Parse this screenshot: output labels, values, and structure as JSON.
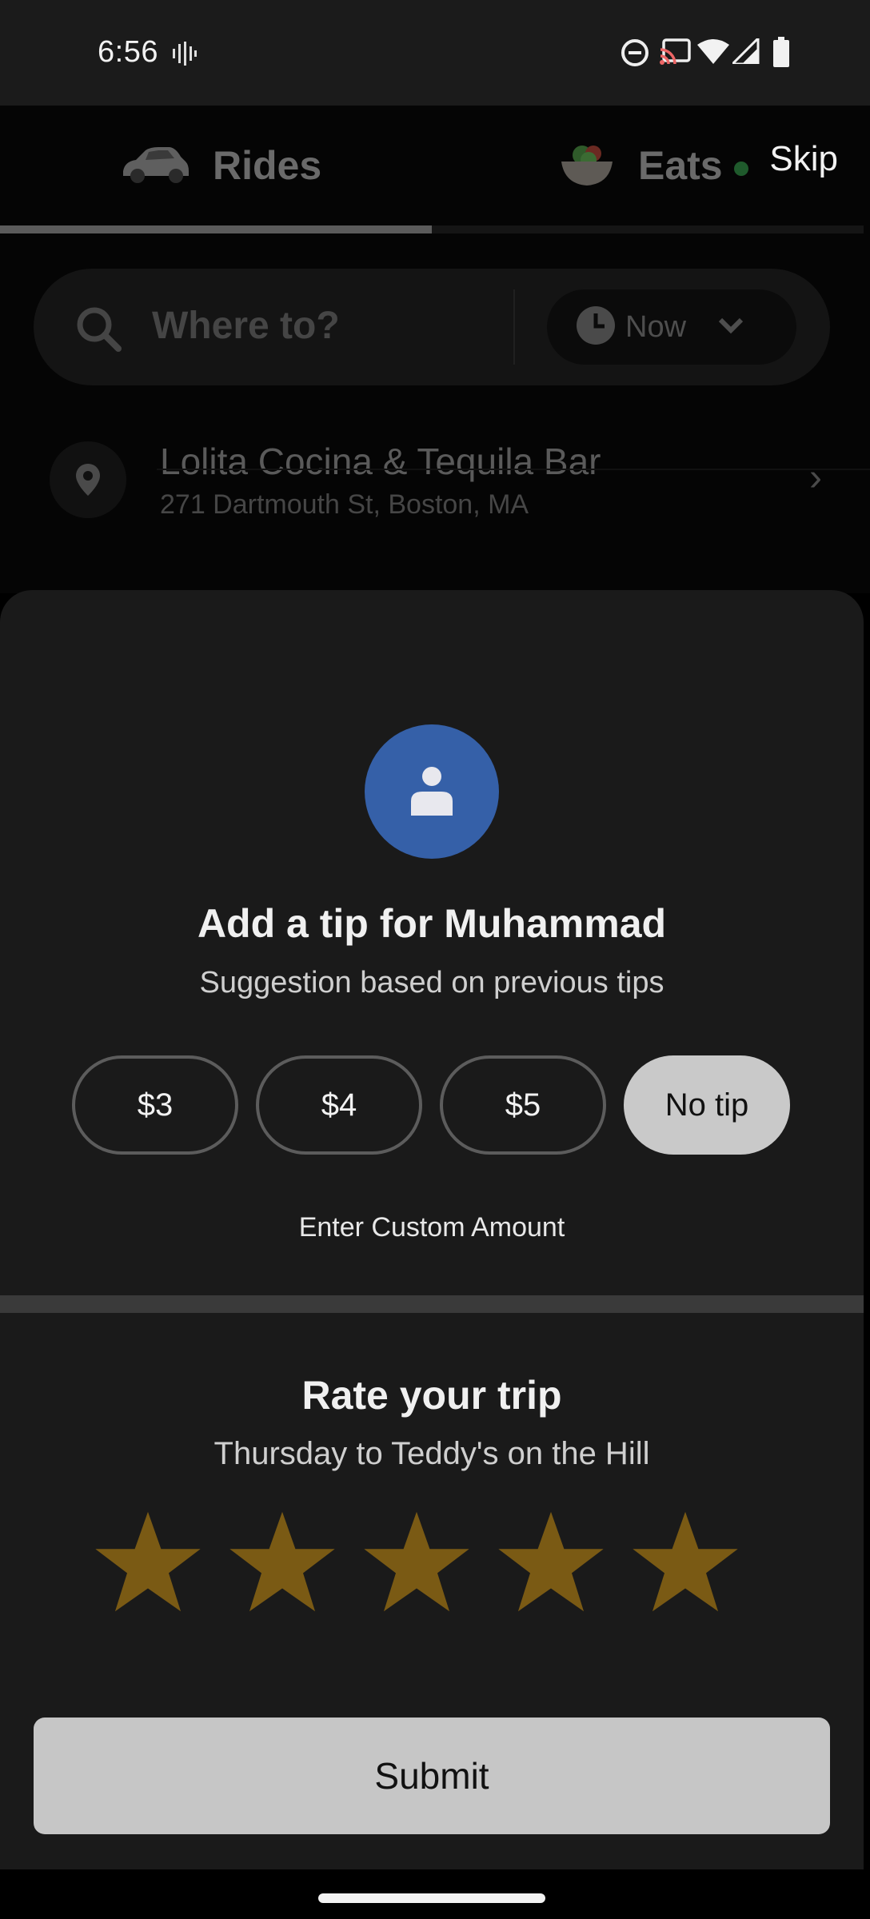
{
  "status_bar": {
    "time": "6:56",
    "icons": [
      "voicemail-icon",
      "do-not-disturb-icon",
      "cast-icon",
      "wifi-icon",
      "signal-icon",
      "battery-icon"
    ]
  },
  "top_tabs": {
    "rides_label": "Rides",
    "eats_label": "Eats",
    "skip_label": "Skip",
    "active_tab": "Rides"
  },
  "search": {
    "placeholder": "Where to?",
    "schedule_label": "Now"
  },
  "recent_place": {
    "title": "Lolita Cocina & Tequila Bar",
    "address": "271 Dartmouth St, Boston, MA"
  },
  "tip": {
    "title": "Add a tip for Muhammad",
    "subtitle": "Suggestion based on previous tips",
    "options": [
      "$3",
      "$4",
      "$5",
      "No tip"
    ],
    "selected": "No tip",
    "custom_label": "Enter Custom Amount"
  },
  "rating": {
    "title": "Rate your trip",
    "subtitle": "Thursday to Teddy's on the Hill",
    "stars_total": 5,
    "stars_selected": 5,
    "star_color": "#7a5a14"
  },
  "submit_label": "Submit",
  "colors": {
    "avatar_bg": "#3560a8",
    "sheet_bg": "#1a1a1a",
    "selected_pill": "#c9c9c9"
  }
}
